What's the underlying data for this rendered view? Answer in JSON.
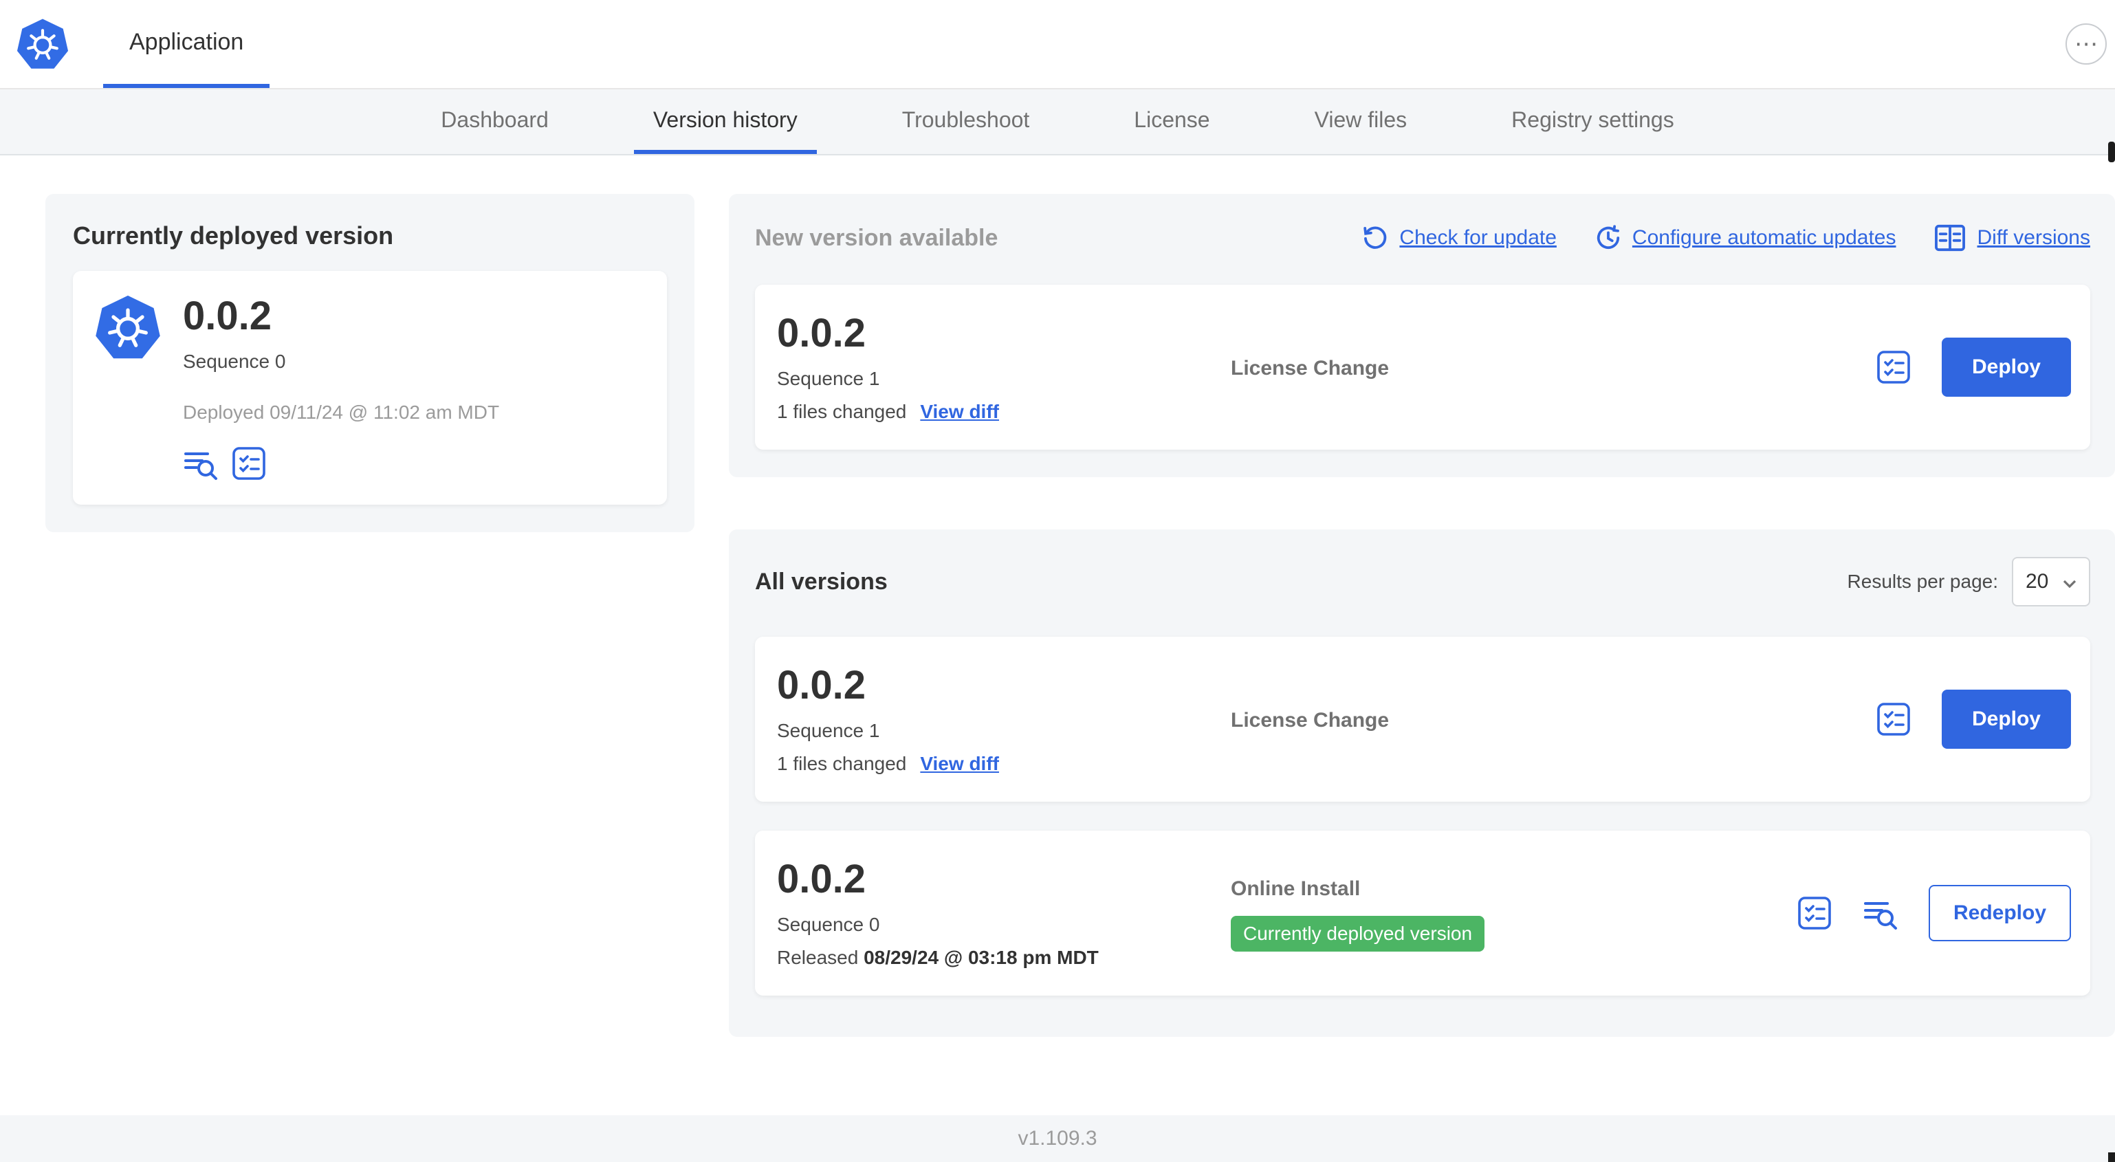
{
  "header": {
    "app_tab": "Application"
  },
  "nav": {
    "tabs": [
      {
        "label": "Dashboard",
        "active": false
      },
      {
        "label": "Version history",
        "active": true
      },
      {
        "label": "Troubleshoot",
        "active": false
      },
      {
        "label": "License",
        "active": false
      },
      {
        "label": "View files",
        "active": false
      },
      {
        "label": "Registry settings",
        "active": false
      }
    ]
  },
  "current_version": {
    "title": "Currently deployed version",
    "version": "0.0.2",
    "sequence": "Sequence 0",
    "deployed": "Deployed 09/11/24 @ 11:02 am MDT"
  },
  "new_version": {
    "title": "New version available",
    "check_for_update": "Check for update",
    "configure_updates": "Configure automatic updates",
    "diff_versions": "Diff versions",
    "row": {
      "version": "0.0.2",
      "sequence": "Sequence 1",
      "files_changed": "1 files changed",
      "view_diff": "View diff",
      "source": "License Change",
      "deploy_label": "Deploy"
    }
  },
  "all_versions": {
    "title": "All versions",
    "results_per_page_label": "Results per page:",
    "results_per_page_value": "20",
    "rows": [
      {
        "version": "0.0.2",
        "sequence": "Sequence 1",
        "files_changed": "1 files changed",
        "view_diff": "View diff",
        "source": "License Change",
        "action_label": "Deploy"
      },
      {
        "version": "0.0.2",
        "sequence": "Sequence 0",
        "released_prefix": "Released",
        "released_date": "08/29/24 @ 03:18 pm MDT",
        "source": "Online Install",
        "badge": "Currently deployed version",
        "action_label": "Redeploy"
      }
    ]
  },
  "footer": {
    "app_version": "v1.109.3"
  },
  "icons": {
    "more": "⋯",
    "names": [
      "kubernetes-logo-icon",
      "view-logs-icon",
      "release-notes-icon",
      "refresh-icon",
      "schedule-icon",
      "diff-icon",
      "chevron-down-icon",
      "ellipsis-icon"
    ]
  },
  "colors": {
    "accent": "#3066e0",
    "k8s_blue": "#326ce5",
    "badge_green": "#4cb564",
    "panel_bg": "#f4f6f8"
  }
}
